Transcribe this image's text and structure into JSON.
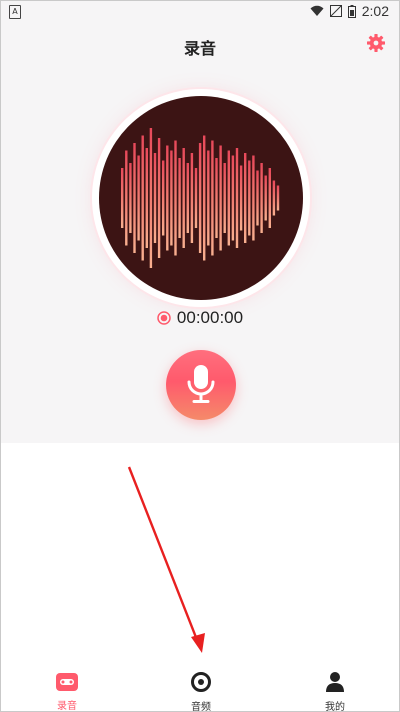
{
  "status_bar": {
    "time": "2:02"
  },
  "header": {
    "title": "录音"
  },
  "recorder": {
    "elapsed": "00:00:00"
  },
  "nav": {
    "items": [
      {
        "label": "录音",
        "icon": "tape-icon",
        "active": true
      },
      {
        "label": "音频",
        "icon": "disc-icon",
        "active": false
      },
      {
        "label": "我的",
        "icon": "user-icon",
        "active": false
      }
    ]
  },
  "colors": {
    "accent": "#ff5a6c",
    "wave_bg": "#3c1414",
    "panel_bg": "#f6f5f6",
    "annotation_arrow": "#e82020"
  }
}
